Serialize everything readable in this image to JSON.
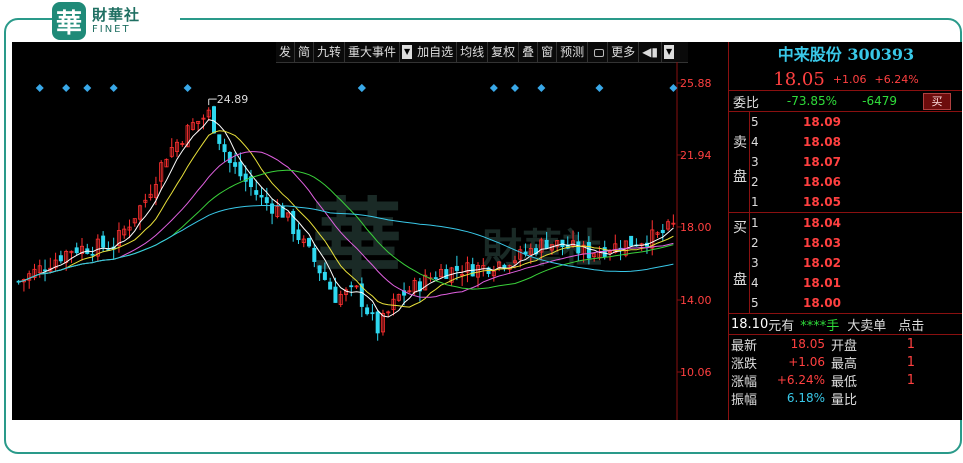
{
  "brand": {
    "mark": "華",
    "name_cn": "財華社",
    "name_en": "FINET"
  },
  "toolbar": {
    "items": [
      "发",
      "简",
      "九转",
      "重大事件",
      "加自选",
      "均线",
      "复权",
      "叠",
      "窗",
      "预测",
      "更多"
    ]
  },
  "stock": {
    "name": "中来股份",
    "code": "300393",
    "price": "18.05",
    "change": "+1.06",
    "change_pct": "+6.24%"
  },
  "weibi": {
    "label": "委比",
    "pct": "-73.85%",
    "diff": "-6479",
    "buy_btn": "买"
  },
  "order_book": {
    "sell_label": [
      "卖",
      "盘"
    ],
    "buy_label": [
      "买",
      "盘"
    ],
    "sell": [
      {
        "level": "5",
        "price": "18.09"
      },
      {
        "level": "4",
        "price": "18.08"
      },
      {
        "level": "3",
        "price": "18.07"
      },
      {
        "level": "2",
        "price": "18.06"
      },
      {
        "level": "1",
        "price": "18.05"
      }
    ],
    "buy": [
      {
        "level": "1",
        "price": "18.04"
      },
      {
        "level": "2",
        "price": "18.03"
      },
      {
        "level": "3",
        "price": "18.02"
      },
      {
        "level": "4",
        "price": "18.01"
      },
      {
        "level": "5",
        "price": "18.00"
      }
    ]
  },
  "trade_line": {
    "price": "18.10",
    "unit": "元有",
    "vol": "****手",
    "big": "大卖单",
    "click": "点击"
  },
  "stats": [
    {
      "k": "最新",
      "v": "18.05",
      "k2": "开盘",
      "v2": "1"
    },
    {
      "k": "涨跌",
      "v": "+1.06",
      "k2": "最高",
      "v2": "1"
    },
    {
      "k": "涨幅",
      "v": "+6.24%",
      "k2": "最低",
      "v2": "1"
    },
    {
      "k": "振幅",
      "v": "6.18%",
      "k2": "量比",
      "v2": ""
    }
  ],
  "chart_data": {
    "type": "candlestick",
    "y_ticks": [
      "25.88",
      "21.94",
      "18.00",
      "14.00",
      "10.06"
    ],
    "ylim": [
      10.06,
      25.88
    ],
    "annotations": [
      {
        "label": "24.89",
        "value": 24.89
      }
    ],
    "colors": {
      "up": "#ff3030",
      "down": "#2fd8f0",
      "ma5": "#ffffff",
      "ma10": "#e8e03a",
      "ma20": "#e060e0",
      "ma30": "#3ad03a",
      "ma60": "#39c8e8",
      "marker": "#39a8e8"
    }
  }
}
